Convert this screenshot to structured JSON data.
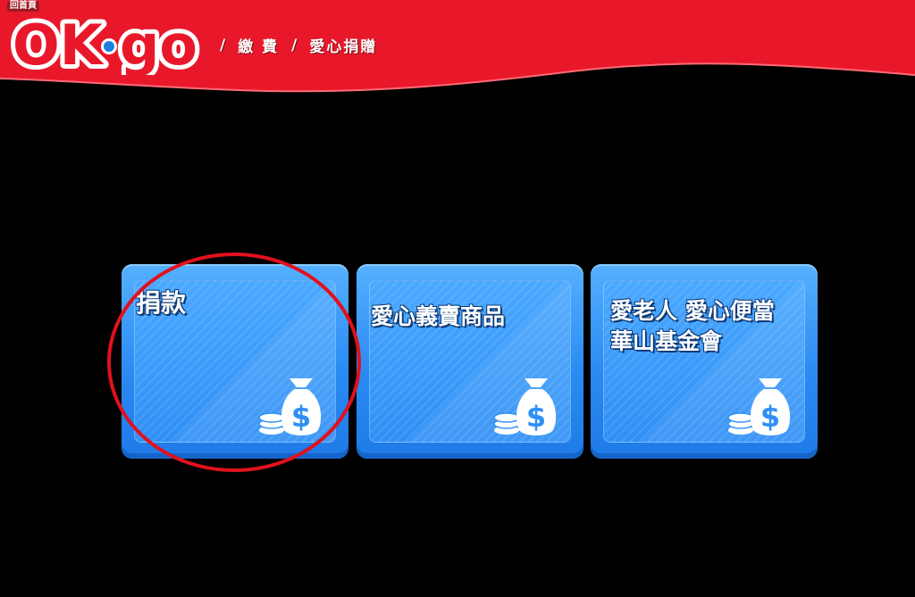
{
  "header": {
    "home_label": "回首頁",
    "logo_text_left": "OK",
    "logo_text_right": "go",
    "breadcrumb": [
      "繳 費",
      "愛心捐贈"
    ],
    "separator": "/"
  },
  "tiles": [
    {
      "label": "捐款",
      "icon": "money-bag-icon"
    },
    {
      "label_line1": "愛心義賣商品",
      "icon": "money-bag-icon"
    },
    {
      "label_line1": "愛老人 愛心便當",
      "label_line2": "華山基金會",
      "icon": "money-bag-icon"
    }
  ],
  "colors": {
    "header_red": "#e8182a",
    "tile_blue": "#2b8bf2",
    "highlight_ring": "#e0111e",
    "background": "#000000"
  }
}
